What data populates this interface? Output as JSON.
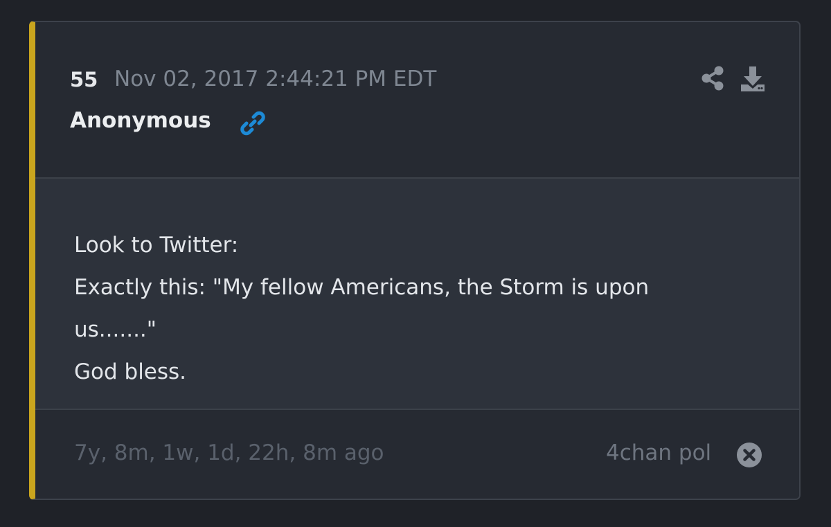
{
  "post": {
    "number": "55",
    "timestamp": "Nov 02, 2017 2:44:21 PM EDT",
    "author": "Anonymous",
    "message_lines": [
      "Look to Twitter:",
      "Exactly this: \"My fellow Americans, the Storm is upon",
      "us.......\"",
      "God bless."
    ],
    "age": "7y, 8m, 1w, 1d, 22h, 8m ago",
    "source": "4chan pol"
  },
  "colors": {
    "accent_bar": "#c9a51e",
    "link_icon": "#1d8ad6",
    "page_background": "#1f2228",
    "card_background": "#262a32",
    "message_background": "#2d323b"
  },
  "icons": {
    "link": "link-icon",
    "share": "share-icon",
    "download": "download-icon",
    "close": "close-circle-icon"
  }
}
